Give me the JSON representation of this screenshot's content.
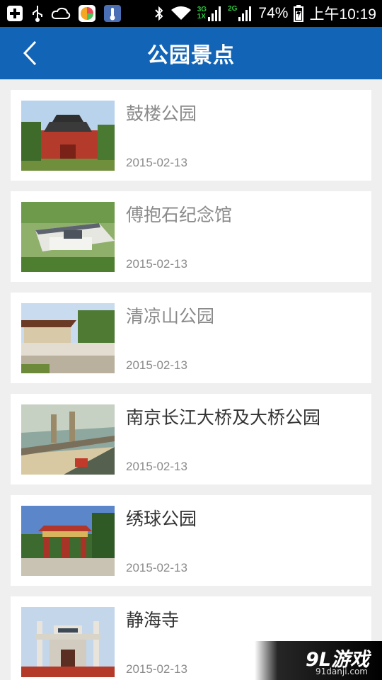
{
  "status_bar": {
    "network_3g": "3G",
    "network_1x": "1X",
    "network_2g": "2G",
    "battery": "74%",
    "time": "上午10:19"
  },
  "header": {
    "title": "公园景点"
  },
  "items": [
    {
      "title": "鼓楼公园",
      "date": "2015-02-13",
      "read": true
    },
    {
      "title": "傅抱石纪念馆",
      "date": "2015-02-13",
      "read": true
    },
    {
      "title": "清凉山公园",
      "date": "2015-02-13",
      "read": true
    },
    {
      "title": "南京长江大桥及大桥公园",
      "date": "2015-02-13",
      "read": false
    },
    {
      "title": "绣球公园",
      "date": "2015-02-13",
      "read": false
    },
    {
      "title": "静海寺",
      "date": "2015-02-13",
      "read": false
    }
  ],
  "watermark": {
    "logo": "9L游戏",
    "url": "91danji.com"
  },
  "colors": {
    "header_bg": "#1164b6",
    "page_bg": "#efefef",
    "read_title": "#8a8a8a",
    "unread_title": "#333333"
  }
}
